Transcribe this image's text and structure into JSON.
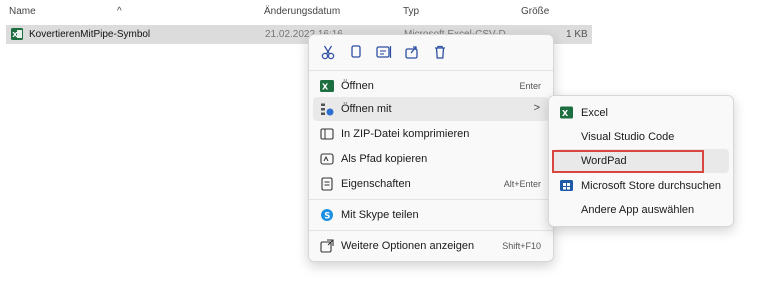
{
  "columns": {
    "name": "Name",
    "date": "Änderungsdatum",
    "type": "Typ",
    "size": "Größe"
  },
  "file": {
    "name": "KovertierenMitPipe-Symbol",
    "date": "21.02.2022 16:16",
    "type": "Microsoft Excel-CSV-D...",
    "size": "1 KB"
  },
  "menu": {
    "toolbar": [
      "cut-icon",
      "copy-icon",
      "rename-icon",
      "share-icon",
      "delete-icon"
    ],
    "items": [
      {
        "label": "Öffnen",
        "shortcut": "Enter",
        "icon": "excel-icon"
      },
      {
        "label": "Öffnen mit",
        "shortcut": "",
        "icon": "open-with-icon",
        "chevron": ">"
      },
      {
        "label": "In ZIP-Datei komprimieren",
        "shortcut": "",
        "icon": "zip-icon"
      },
      {
        "label": "Als Pfad kopieren",
        "shortcut": "",
        "icon": "copy-path-icon"
      },
      {
        "label": "Eigenschaften",
        "shortcut": "Alt+Enter",
        "icon": "properties-icon"
      },
      {
        "label": "Mit Skype teilen",
        "shortcut": "",
        "icon": "skype-icon"
      },
      {
        "label": "Weitere Optionen anzeigen",
        "shortcut": "Shift+F10",
        "icon": "more-options-icon"
      }
    ]
  },
  "submenu": {
    "items": [
      {
        "label": "Excel",
        "icon": "excel-icon"
      },
      {
        "label": "Visual Studio Code",
        "icon": ""
      },
      {
        "label": "WordPad",
        "icon": ""
      },
      {
        "label": "Microsoft Store durchsuchen",
        "icon": "store-icon"
      },
      {
        "label": "Andere App auswählen",
        "icon": ""
      }
    ]
  },
  "colors": {
    "highlight_box": "#d9463e",
    "excel_green": "#1d6f42"
  }
}
